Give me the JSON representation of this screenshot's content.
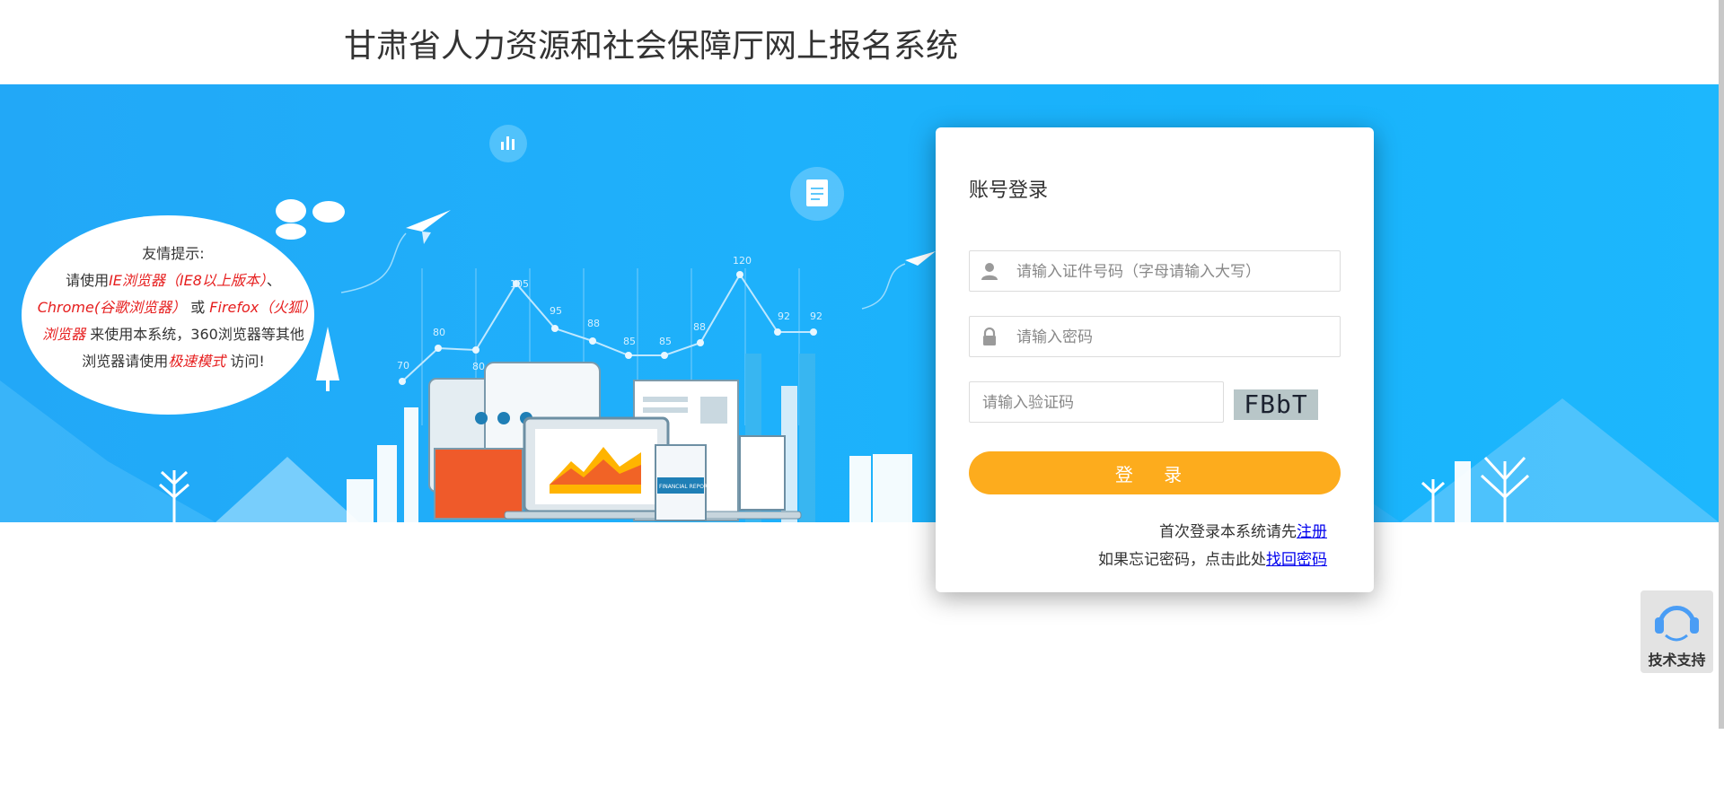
{
  "header": {
    "title": "甘肃省人力资源和社会保障厅网上报名系统"
  },
  "tips": {
    "title": "友情提示:",
    "line1_prefix": "请使用",
    "ie": "IE浏览器（IE8以上版本）",
    "sep1": "、",
    "chrome": "Chrome(谷歌浏览器）",
    "or": "或",
    "firefox": "Firefox（火狐）浏览器",
    "mid": "来使用本系统，360浏览器等其他浏览器请使用",
    "speed_mode": "极速模式",
    "suffix": "访问!"
  },
  "chart_labels": [
    "70",
    "80",
    "80",
    "105",
    "95",
    "88",
    "85",
    "85",
    "88",
    "120",
    "92",
    "92"
  ],
  "illustration": {
    "report_label": "FINANCIAL REPORT"
  },
  "login": {
    "title": "账号登录",
    "id_placeholder": "请输入证件号码（字母请输入大写）",
    "password_placeholder": "请输入密码",
    "captcha_placeholder": "请输入验证码",
    "captcha_text": "FBbT",
    "submit_label": "登 录",
    "register_prefix": "首次登录本系统请先",
    "register_link": "注册",
    "forgot_prefix": "如果忘记密码，点击此处",
    "forgot_link": "找回密码"
  },
  "support": {
    "label": "技术支持"
  },
  "colors": {
    "banner": "#22a8f7",
    "button": "#fdac1d",
    "link": "#0000ee",
    "tip_red": "#e61e1e"
  }
}
